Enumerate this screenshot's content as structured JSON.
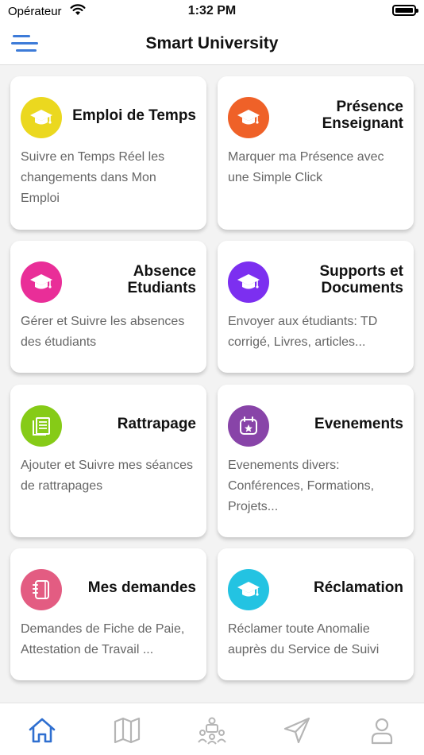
{
  "status_bar": {
    "carrier": "Opérateur",
    "time": "1:32 PM"
  },
  "header": {
    "title": "Smart University",
    "menu_icon": "menu-icon"
  },
  "cards": [
    {
      "title": "Emploi de Temps",
      "description": "Suivre en Temps Réel les changements dans Mon Emploi",
      "icon": "graduation-cap-icon",
      "color": "#ebd81f"
    },
    {
      "title": "Présence Enseignant",
      "description": "Marquer ma Présence avec une Simple Click",
      "icon": "graduation-cap-icon",
      "color": "#ef6128"
    },
    {
      "title": "Absence Etudiants",
      "description": "Gérer et Suivre les absences des étudiants",
      "icon": "graduation-cap-icon",
      "color": "#e92e98"
    },
    {
      "title": "Supports et Documents",
      "description": "Envoyer aux étudiants: TD corrigé, Livres, articles...",
      "icon": "graduation-cap-icon",
      "color": "#7c2ff0"
    },
    {
      "title": "Rattrapage",
      "description": "Ajouter et Suivre mes séances de rattrapages",
      "icon": "book-icon",
      "color": "#86cb17"
    },
    {
      "title": "Evenements",
      "description": "Evenements divers: Conférences, Formations, Projets...",
      "icon": "calendar-icon",
      "color": "#8844a8"
    },
    {
      "title": "Mes demandes",
      "description": "Demandes de Fiche de Paie, Attestation de Travail ...",
      "icon": "notebook-icon",
      "color": "#e35c82"
    },
    {
      "title": "Réclamation",
      "description": "Réclamer toute Anomalie auprès du Service de Suivi",
      "icon": "graduation-cap-icon",
      "color": "#23c3e2"
    }
  ],
  "bottom_nav": [
    {
      "icon": "home-icon",
      "active": true
    },
    {
      "icon": "map-icon",
      "active": false
    },
    {
      "icon": "team-icon",
      "active": false
    },
    {
      "icon": "send-icon",
      "active": false
    },
    {
      "icon": "profile-icon",
      "active": false
    }
  ],
  "colors": {
    "accent": "#3d7bd8",
    "nav_active": "#2f6fd0",
    "nav_inactive": "#b5b5b5"
  }
}
